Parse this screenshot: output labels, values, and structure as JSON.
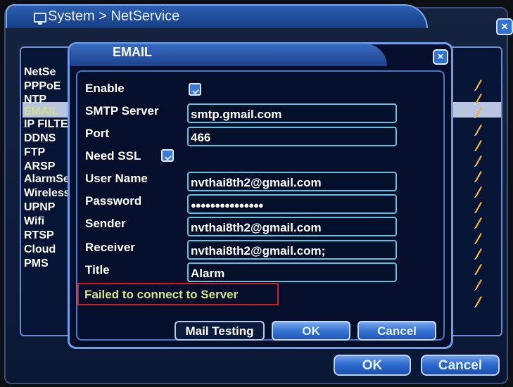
{
  "window": {
    "title": "System > NetService",
    "close_icon": "close-icon"
  },
  "service_list": {
    "header": "NetSe",
    "items": [
      {
        "label": "PPPoE",
        "selected": false
      },
      {
        "label": "NTP",
        "selected": false
      },
      {
        "label": "EMAIL",
        "selected": true
      },
      {
        "label": "IP FILTER",
        "selected": false
      },
      {
        "label": "DDNS",
        "selected": false
      },
      {
        "label": "FTP",
        "selected": false
      },
      {
        "label": "ARSP",
        "selected": false
      },
      {
        "label": "AlarmServer",
        "selected": false
      },
      {
        "label": "Wireless",
        "selected": false
      },
      {
        "label": "UPNP",
        "selected": false
      },
      {
        "label": "Wifi",
        "selected": false
      },
      {
        "label": "RTSP",
        "selected": false
      },
      {
        "label": "Cloud",
        "selected": false
      },
      {
        "label": "PMS",
        "selected": false
      }
    ],
    "edit_icon": "pencil-icon"
  },
  "outer_buttons": {
    "ok": "OK",
    "cancel": "Cancel"
  },
  "email_dialog": {
    "title": "EMAIL",
    "fields": {
      "enable_label": "Enable",
      "smtp_label": "SMTP Server",
      "smtp_value": "smtp.gmail.com",
      "port_label": "Port",
      "port_value": "466",
      "ssl_label": "Need SSL",
      "username_label": "User Name",
      "username_value": "nvthai8th2@gmail.com",
      "password_label": "Password",
      "password_value": "●●●●●●●●●●●●●●●",
      "sender_label": "Sender",
      "sender_value": "nvthai8th2@gmail.com",
      "receiver_label": "Receiver",
      "receiver_value": "nvthai8th2@gmail.com;",
      "title_label": "Title",
      "title_value": "Alarm"
    },
    "status": "Failed to connect to Server",
    "buttons": {
      "mail_testing": "Mail Testing",
      "ok": "OK",
      "cancel": "Cancel"
    }
  },
  "colors": {
    "accent": "#2e72d2",
    "field_border": "#5ec3de",
    "error_border": "#d21d20",
    "status_text": "#d8e37a"
  }
}
